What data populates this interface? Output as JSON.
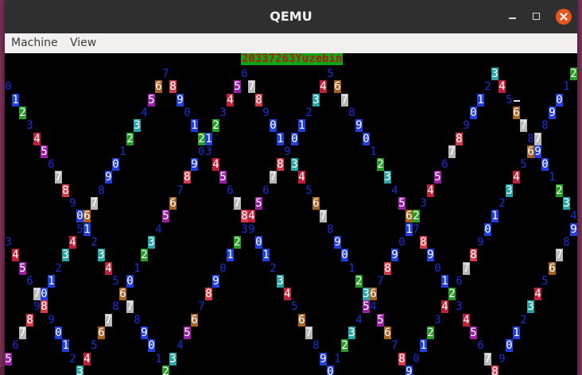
{
  "window": {
    "title": "QEMU"
  },
  "menubar": {
    "items": [
      "Machine",
      "View"
    ]
  },
  "screen": {
    "banner": "20337263Yuzebin",
    "digit_bg_colors": {
      "0": "#000000",
      "1": "#1f3fe0",
      "2": "#25a025",
      "3": "#26a6a6",
      "4": "#c01f3a",
      "5": "#9b1fa6",
      "6": "#a8641f",
      "7": "#b9b9b9",
      "8": "#d63a4a",
      "9": "#1f3fe0"
    },
    "colors": {
      "plain_digit": "#1a30d8",
      "banner_bg": "#11a611",
      "banner_fg": "#b01a1a"
    }
  }
}
